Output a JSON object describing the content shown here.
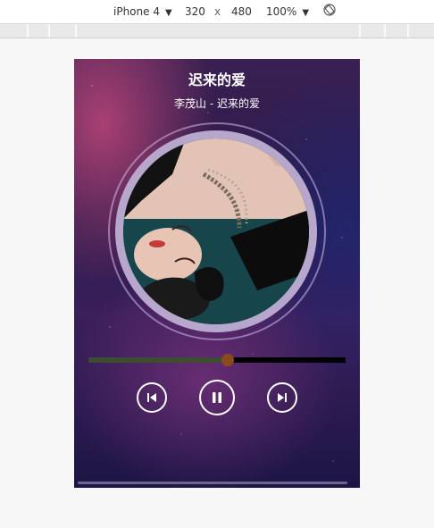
{
  "devtools": {
    "device": "iPhone 4",
    "width": "320",
    "times": "x",
    "height": "480",
    "zoom": "100%",
    "caret": "▼"
  },
  "player": {
    "title": "迟来的爱",
    "subtitle": "李茂山 - 迟来的爱",
    "progress": 0.54,
    "state": "playing"
  },
  "colors": {
    "accent": "#8b4a1e",
    "progress_fill": "#3d4d33",
    "track": "#000000"
  },
  "icons": {
    "prev": "skip-previous-icon",
    "pause": "pause-icon",
    "next": "skip-next-icon",
    "rotate": "rotate-device-icon"
  }
}
